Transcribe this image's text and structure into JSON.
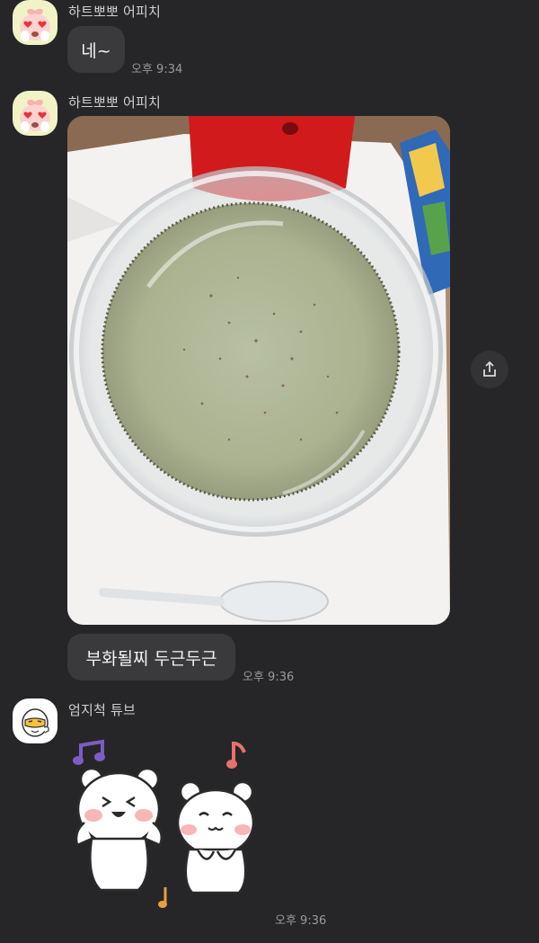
{
  "messages": [
    {
      "sender": "하트뽀뽀 어피치",
      "text": "네~",
      "time": "오후 9:34"
    },
    {
      "sender": "하트뽀뽀 어피치",
      "image": "dish-photo",
      "text": "부화될찌 두근두근",
      "time": "오후 9:36"
    },
    {
      "sender": "엄지척 튜브",
      "sticker": "dancing-bears-sticker",
      "time": "오후 9:36"
    }
  ],
  "icons": {
    "share": "share-icon",
    "apeach_avatar": "apeach-heart-eyes-icon",
    "tube_avatar": "tube-thumbs-up-icon"
  },
  "colors": {
    "background": "#262628",
    "bubble": "#3a3a3d",
    "timestamp": "#9a9a9a"
  }
}
